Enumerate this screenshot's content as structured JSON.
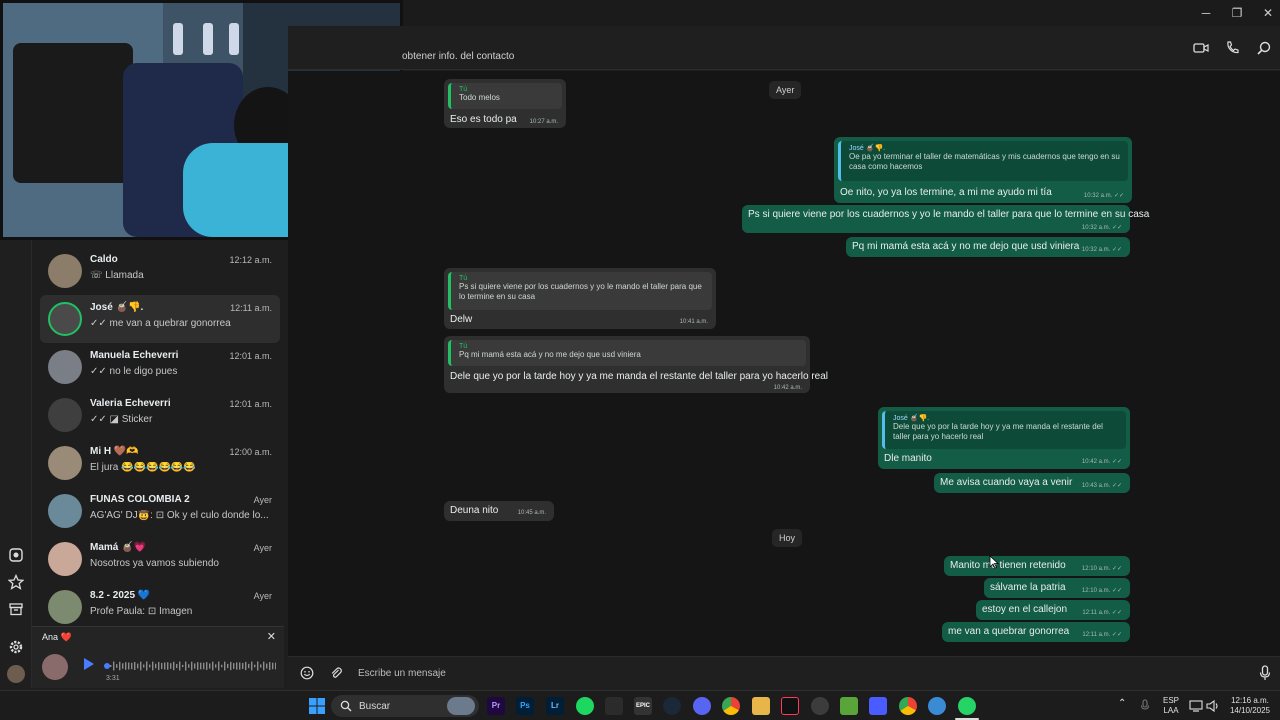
{
  "header": {
    "subtitle": "obtener info. del contacto"
  },
  "chats": [
    {
      "name": "Caldo",
      "time": "12:12 a.m.",
      "preview": "☏ Llamada"
    },
    {
      "name": "José 🧉👎.",
      "time": "12:11 a.m.",
      "preview": "✓✓ me van a quebrar gonorrea"
    },
    {
      "name": "Manuela Echeverri",
      "time": "12:01 a.m.",
      "preview": "✓✓ no le digo pues"
    },
    {
      "name": "Valeria Echeverri",
      "time": "12:01 a.m.",
      "preview": "✓✓ ◪ Sticker"
    },
    {
      "name": "Mi H 🤎🫶",
      "time": "12:00 a.m.",
      "preview": "El jura 😂😂😂😂😂😂"
    },
    {
      "name": "FUNAS COLOMBIA 2",
      "time": "Ayer",
      "preview": "AG'AG' DJ🤠: ⊡ Ok y el culo donde lo..."
    },
    {
      "name": "Mamá 🧉💗",
      "time": "Ayer",
      "preview": "Nosotros ya vamos subiendo"
    },
    {
      "name": "8.2 - 2025 💙",
      "time": "Ayer",
      "preview": "Profe Paula: ⊡ Imagen"
    }
  ],
  "audio": {
    "title": "Ana ❤️",
    "duration": "3:31"
  },
  "date_labels": {
    "ayer": "Ayer",
    "hoy": "Hoy"
  },
  "messages": [
    {
      "quote_author": "Tú",
      "quote_text": "Todo melos",
      "text": "Eso es todo pa",
      "time": "10:27 a.m."
    },
    {
      "quote_author": "José 🧉👎.",
      "quote_text": "Oe pa yo terminar el taller de matemáticas y mis cuadernos que tengo en su casa como hacemos",
      "text": "Oe nito, yo ya los termine, a mi me ayudo mi tía",
      "time": "10:32 a.m. ✓✓"
    },
    {
      "text": "Ps si quiere viene por los cuadernos y yo le mando el taller para que lo termine en su casa",
      "time": "10:32 a.m. ✓✓"
    },
    {
      "text": "Pq mi mamá esta acá y no me dejo que usd viniera",
      "time": "10:32 a.m. ✓✓"
    },
    {
      "quote_author": "Tú",
      "quote_text": "Ps si quiere viene por los cuadernos y yo le mando el taller para que lo termine en su casa",
      "text": "Delw",
      "time": "10:41 a.m."
    },
    {
      "quote_author": "Tú",
      "quote_text": "Pq mi mamá esta acá y no me dejo que usd viniera",
      "text": "Dele que yo por la tarde hoy y ya me manda el restante del taller para yo hacerlo real",
      "time": "10:42 a.m."
    },
    {
      "quote_author": "José 🧉👎.",
      "quote_text": "Dele que yo por la tarde hoy y ya me manda el restante del taller para yo hacerlo real",
      "text": "Dle manito",
      "time": "10:42 a.m. ✓✓"
    },
    {
      "text": "Me avisa cuando vaya a venir",
      "time": "10:43 a.m. ✓✓"
    },
    {
      "text": "Deuna nito",
      "time": "10:45 a.m."
    },
    {
      "text": "Manito me tienen retenido",
      "time": "12:10 a.m. ✓✓"
    },
    {
      "text": "sálvame la patria",
      "time": "12:10 a.m. ✓✓"
    },
    {
      "text": "estoy en el callejon",
      "time": "12:11 a.m. ✓✓"
    },
    {
      "text": "me van a quebrar gonorrea",
      "time": "12:11 a.m. ✓✓"
    }
  ],
  "composer": {
    "placeholder": "Escribe un mensaje"
  },
  "taskbar": {
    "search_label": "Buscar",
    "language": "ESP",
    "layout": "LAA",
    "time": "12:16 a.m.",
    "date": "14/10/2025",
    "app_labels": {
      "premiere": "Pr",
      "photoshop": "Ps",
      "lightroom": "Lr",
      "epic": "EPIC"
    }
  },
  "colors": {
    "accent": "#21c063",
    "outgoing": "#135c45",
    "incoming": "#2f2f2f"
  }
}
